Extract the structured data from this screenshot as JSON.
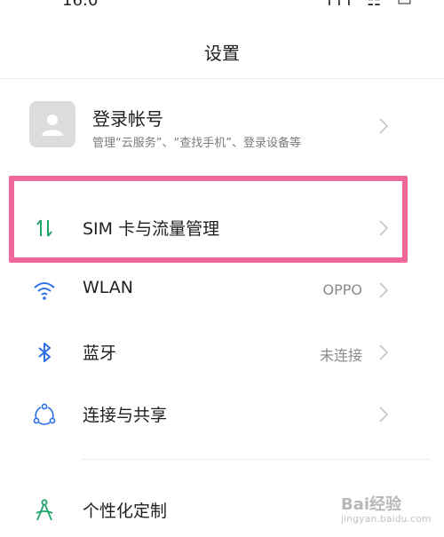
{
  "status_bar": {
    "left_text": "16:0",
    "right_icons": "ıll ☷ ▭"
  },
  "header": {
    "title": "设置"
  },
  "account": {
    "title": "登录帐号",
    "subtitle": "管理“云服务”、“查找手机”、登录设备等",
    "avatar_icon": "user-avatar-icon"
  },
  "settings": [
    {
      "id": "sim",
      "label": "SIM 卡与流量管理",
      "value": "",
      "icon": "sim-data-arrows-icon",
      "color": "#1fa46a"
    },
    {
      "id": "wlan",
      "label": "WLAN",
      "value": "OPPO",
      "icon": "wifi-icon",
      "color": "#2d6fe6"
    },
    {
      "id": "bluetooth",
      "label": "蓝牙",
      "value": "未连接",
      "icon": "bluetooth-icon",
      "color": "#2d6fe6"
    },
    {
      "id": "connection",
      "label": "连接与共享",
      "value": "",
      "icon": "connection-share-icon",
      "color": "#2d6fe6"
    },
    {
      "id": "personalize",
      "label": "个性化定制",
      "value": "",
      "icon": "personalize-icon",
      "color": "#1fa46a"
    }
  ],
  "highlight_color": "#f0679b",
  "watermark": {
    "brand": "Bai经验",
    "url": "jingyan.baidu.com"
  }
}
